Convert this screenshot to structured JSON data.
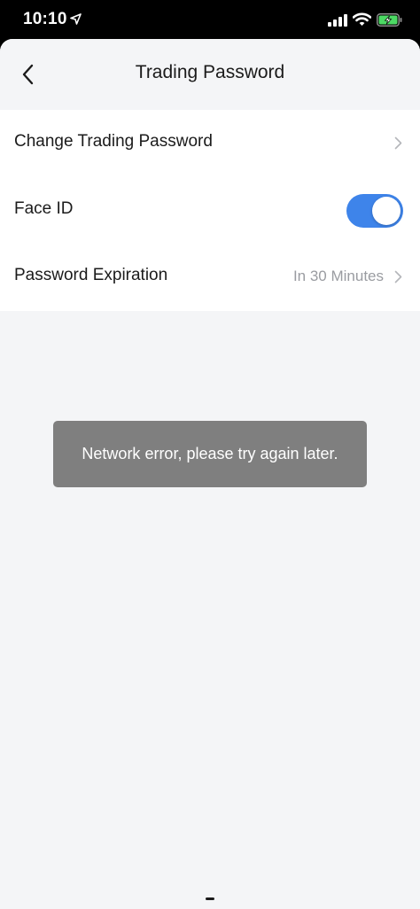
{
  "status_bar": {
    "time": "10:10",
    "icons": [
      "location-arrow-icon",
      "cellular-signal-icon",
      "wifi-icon",
      "battery-charging-icon"
    ],
    "battery_color": "#4cd964"
  },
  "nav": {
    "back_icon": "chevron-left-icon",
    "title": "Trading Password"
  },
  "settings": {
    "change_password": {
      "label": "Change Trading Password",
      "icon": "chevron-right-icon"
    },
    "face_id": {
      "label": "Face ID",
      "enabled": true,
      "toggle_color": "#3e84ea"
    },
    "password_expiration": {
      "label": "Password Expiration",
      "value": "In 30 Minutes",
      "icon": "chevron-right-icon"
    }
  },
  "toast": {
    "message": "Network error, please try again later."
  }
}
